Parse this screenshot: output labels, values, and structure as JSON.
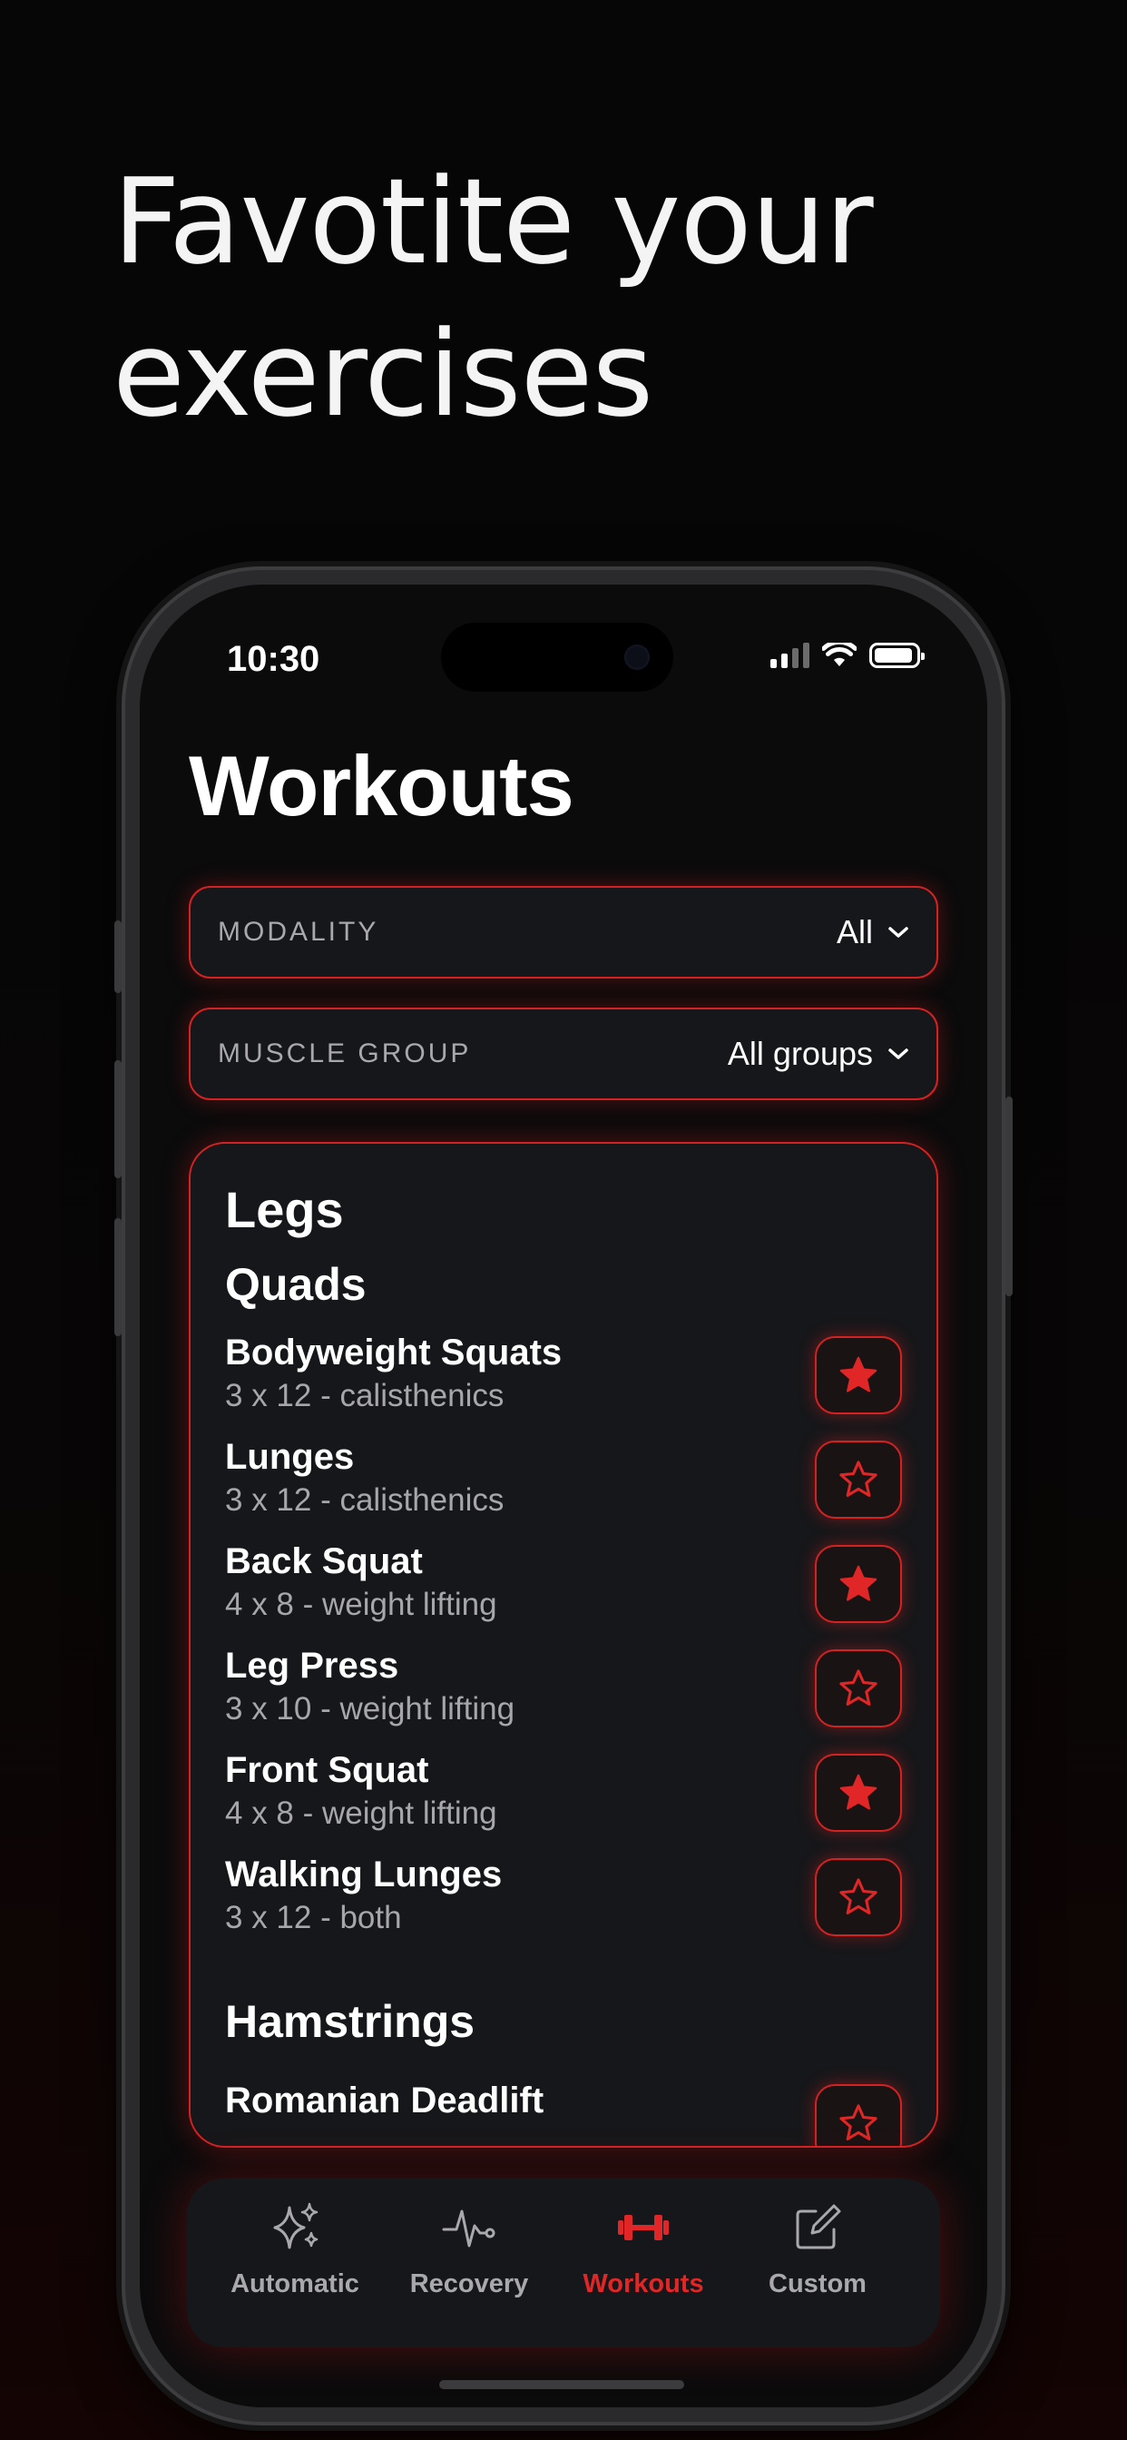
{
  "headline": [
    "Favotite your",
    "exercises"
  ],
  "status": {
    "time": "10:30"
  },
  "page_title": "Workouts",
  "filters": [
    {
      "label": "MODALITY",
      "value": "All"
    },
    {
      "label": "MUSCLE GROUP",
      "value": "All groups"
    }
  ],
  "sections": {
    "title": "Legs",
    "groups": [
      {
        "title": "Quads",
        "exercises": [
          {
            "name": "Bodyweight Squats",
            "detail": "3 x 12 - calisthenics",
            "favorite": true
          },
          {
            "name": "Lunges",
            "detail": "3 x 12 - calisthenics",
            "favorite": false
          },
          {
            "name": "Back Squat",
            "detail": "4 x 8 - weight lifting",
            "favorite": true
          },
          {
            "name": "Leg Press",
            "detail": "3 x 10 - weight lifting",
            "favorite": false
          },
          {
            "name": "Front Squat",
            "detail": "4 x 8 - weight lifting",
            "favorite": true
          },
          {
            "name": "Walking Lunges",
            "detail": "3 x 12 - both",
            "favorite": false
          }
        ]
      },
      {
        "title": "Hamstrings",
        "exercises": [
          {
            "name": "Romanian Deadlift",
            "detail": "",
            "favorite": false
          }
        ]
      }
    ]
  },
  "tabs": [
    {
      "label": "Automatic",
      "icon": "sparkles-icon",
      "active": false
    },
    {
      "label": "Recovery",
      "icon": "heart-pulse-icon",
      "active": false
    },
    {
      "label": "Workouts",
      "icon": "dumbbell-icon",
      "active": true
    },
    {
      "label": "Custom",
      "icon": "edit-square-icon",
      "active": false
    }
  ],
  "colors": {
    "accent": "#e02626",
    "background": "#0b0b0c",
    "card": "#16171a",
    "muted_text": "#a7a7ab"
  }
}
